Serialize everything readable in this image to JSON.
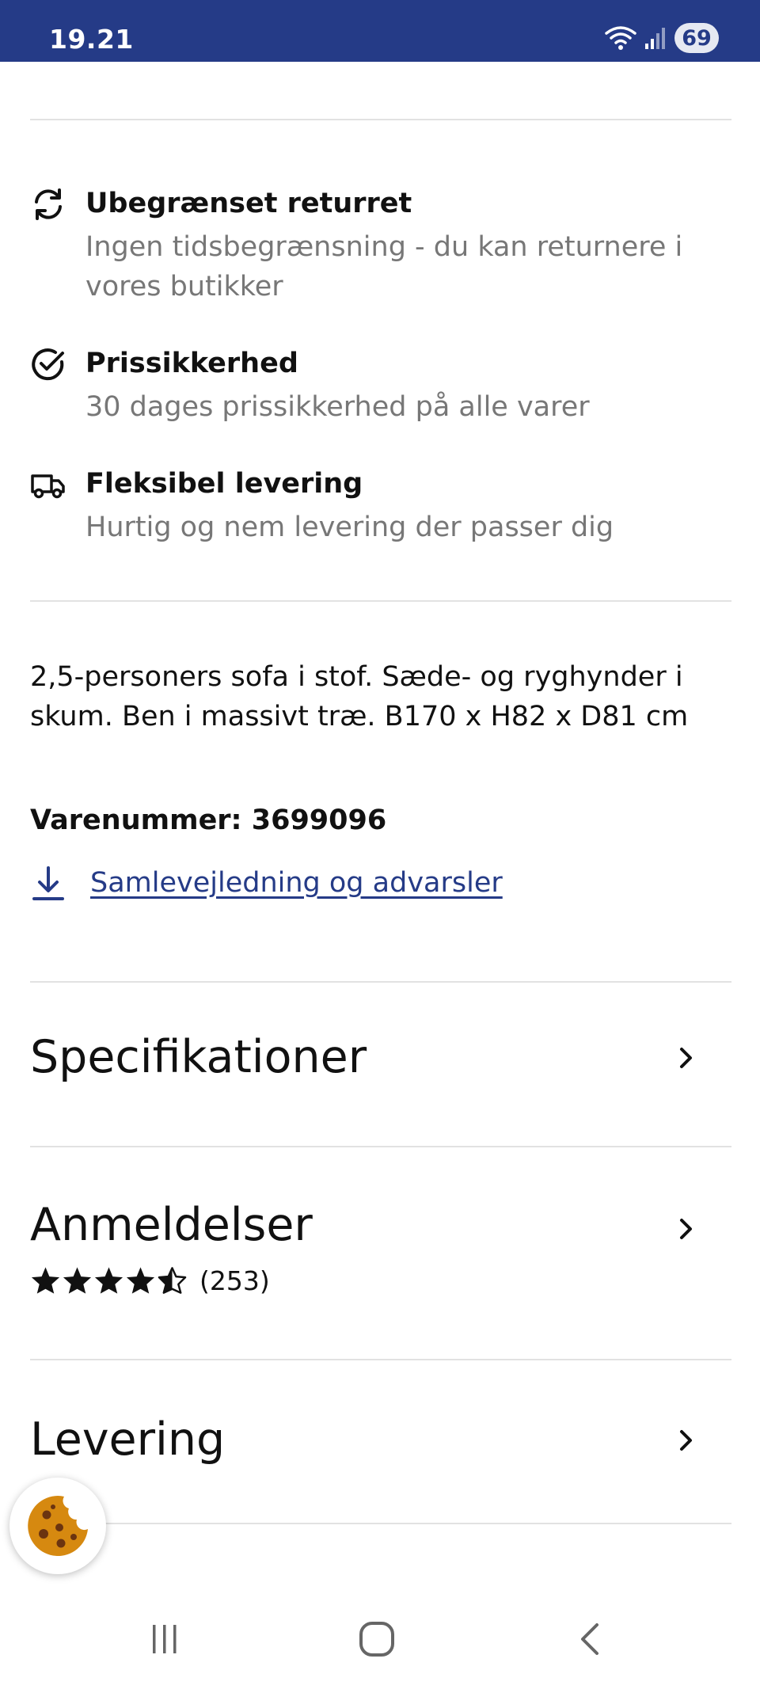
{
  "status_bar": {
    "time": "19.21",
    "battery": "69",
    "icons": [
      "wifi-icon",
      "signal-icon",
      "battery-icon"
    ]
  },
  "benefits": [
    {
      "icon": "refresh-icon",
      "title": "Ubegrænset returret",
      "description": "Ingen tidsbegrænsning - du kan returnere i vores butikker"
    },
    {
      "icon": "check-circle-icon",
      "title": "Prissikkerhed",
      "description": "30 dages prissikkerhed på alle varer"
    },
    {
      "icon": "truck-icon",
      "title": "Fleksibel levering",
      "description": "Hurtig og nem levering der passer dig"
    }
  ],
  "product": {
    "description": "2,5-personers sofa i stof. Sæde- og ryghynder i skum. Ben i massivt træ. B170 x H82 x D81 cm",
    "article_label": "Varenummer:",
    "article_number": "3699096",
    "download_link": "Samlevejledning og advarsler"
  },
  "sections": {
    "specifications": "Specifikationer",
    "reviews": "Anmeldelser",
    "delivery": "Levering"
  },
  "reviews": {
    "rating": 4.5,
    "max_rating": 5,
    "count": "(253)"
  },
  "colors": {
    "brand_blue": "#253b87",
    "muted_text": "#777777",
    "cookie": "#d68910"
  },
  "navigation": [
    "recent-apps-icon",
    "home-icon",
    "back-icon"
  ]
}
